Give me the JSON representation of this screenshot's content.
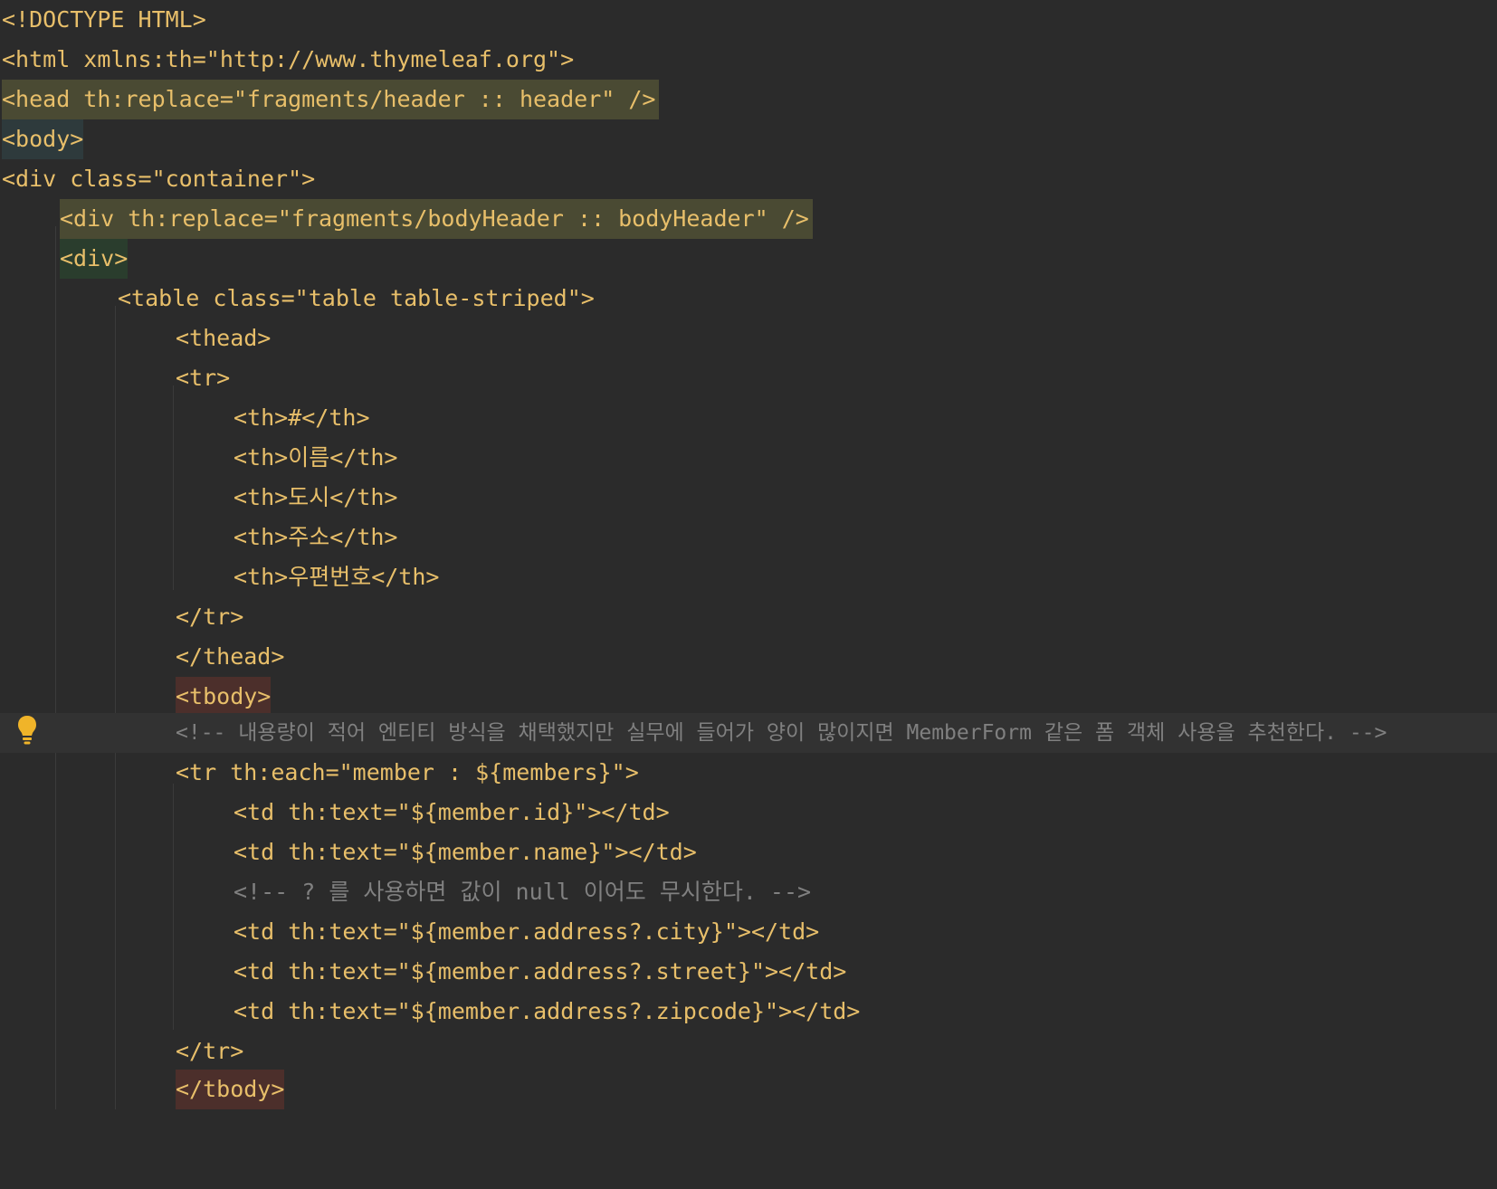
{
  "editor": {
    "language": "html-thymeleaf",
    "lines": [
      {
        "id": "l1",
        "text": "<!DOCTYPE HTML>"
      },
      {
        "id": "l2",
        "text": "<html xmlns:th=\"http://www.thymeleaf.org\">"
      },
      {
        "id": "l3",
        "text": "<head th:replace=\"fragments/header :: header\" />"
      },
      {
        "id": "l4",
        "text": "<body>"
      },
      {
        "id": "l5",
        "text": "<div class=\"container\">"
      },
      {
        "id": "l6",
        "text": "<div th:replace=\"fragments/bodyHeader :: bodyHeader\" />"
      },
      {
        "id": "l7",
        "text": "<div>"
      },
      {
        "id": "l8",
        "text": "<table class=\"table table-striped\">"
      },
      {
        "id": "l9",
        "text": "<thead>"
      },
      {
        "id": "l10",
        "text": "<tr>"
      },
      {
        "id": "l11",
        "text": "<th>#</th>"
      },
      {
        "id": "l12",
        "text": "<th>이름</th>"
      },
      {
        "id": "l13",
        "text": "<th>도시</th>"
      },
      {
        "id": "l14",
        "text": "<th>주소</th>"
      },
      {
        "id": "l15",
        "text": "<th>우편번호</th>"
      },
      {
        "id": "l16",
        "text": "</tr>"
      },
      {
        "id": "l17",
        "text": "</thead>"
      },
      {
        "id": "l18",
        "text": "<tbody>"
      },
      {
        "id": "l19",
        "text": "<!-- 내용량이 적어 엔티티 방식을 채택했지만 실무에 들어가 양이 많이지면 MemberForm 같은 폼 객체 사용을 추천한다. -->"
      },
      {
        "id": "l20",
        "text": "<tr th:each=\"member : ${members}\">"
      },
      {
        "id": "l21",
        "text": "<td th:text=\"${member.id}\"></td>"
      },
      {
        "id": "l22",
        "text": "<td th:text=\"${member.name}\"></td>"
      },
      {
        "id": "l23",
        "text": "<!-- ? 를 사용하면 값이 null 이어도 무시한다. -->"
      },
      {
        "id": "l24",
        "text": "<td th:text=\"${member.address?.city}\"></td>"
      },
      {
        "id": "l25",
        "text": "<td th:text=\"${member.address?.street}\"></td>"
      },
      {
        "id": "l26",
        "text": "<td th:text=\"${member.address?.zipcode}\"></td>"
      },
      {
        "id": "l27",
        "text": "</tr>"
      },
      {
        "id": "l28",
        "text": "</tbody>"
      }
    ],
    "gutter": {
      "intention_icon": "lightbulb-icon",
      "intention_icon_color": "#f0b429"
    }
  },
  "colors": {
    "background": "#2b2b2b",
    "tag": "#e8bf6a",
    "attribute": "#bababa",
    "namespace": "#9876aa",
    "string": "#a5c261",
    "comment": "#808080",
    "text": "#a9b7c6"
  }
}
